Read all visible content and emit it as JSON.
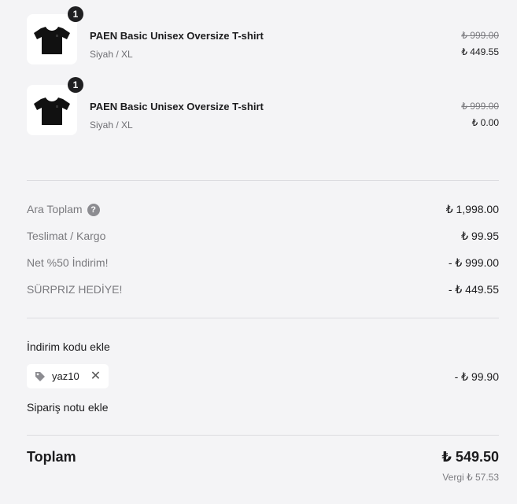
{
  "items": [
    {
      "quantity": "1",
      "title": "PAEN Basic Unisex Oversize T-shirt",
      "variant": "Siyah / XL",
      "compare_price": "₺ 999.00",
      "price": "₺ 449.55",
      "image": "black-tshirt"
    },
    {
      "quantity": "1",
      "title": "PAEN Basic Unisex Oversize T-shirt",
      "variant": "Siyah / XL",
      "compare_price": "₺ 999.00",
      "price": "₺ 0.00",
      "image": "black-tshirt"
    }
  ],
  "summary": {
    "subtotal_label": "Ara Toplam",
    "subtotal_help": "?",
    "subtotal_value": "₺ 1,998.00",
    "shipping_label": "Teslimat / Kargo",
    "shipping_value": "₺ 99.95",
    "discount1_label": "Net %50 İndirim!",
    "discount1_value": "- ₺ 999.00",
    "discount2_label": "SÜRPRIZ HEDİYE!",
    "discount2_value": "- ₺ 449.55"
  },
  "discount_code": {
    "add_label": "İndirim kodu ekle",
    "code": "yaz10",
    "remove_symbol": "✕",
    "amount": "- ₺ 99.90"
  },
  "order_note": {
    "add_label": "Sipariş notu ekle"
  },
  "total": {
    "label": "Toplam",
    "value": "₺ 549.50",
    "tax": "Vergi ₺ 57.53"
  },
  "colors": {
    "background": "#f4f4f6",
    "text": "#1c1c1e",
    "muted": "#7a7a7e",
    "badge": "#1f1f21",
    "divider": "#dcdce0"
  }
}
